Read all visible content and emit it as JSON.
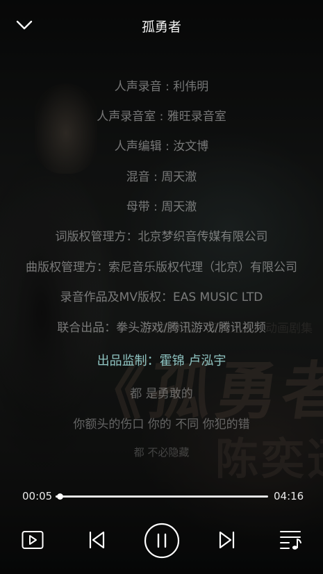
{
  "header": {
    "title": "孤勇者",
    "back_icon": "chevron-down-icon"
  },
  "lyrics": [
    "人声录音 : 利伟明",
    "人声录音室 : 雅旺录音室",
    "人声编辑 : 汝文博",
    "混音 : 周天澈",
    "母带 : 周天澈",
    "词版权管理方：北京梦织音传媒有限公司",
    "曲版权管理方：索尼音乐版权代理（北京）有限公司",
    "录音作品及MV版权：EAS MUSIC LTD",
    "联合出品：拳头游戏/腾讯游戏/腾讯视频",
    "出品监制：霍锦 卢泓宇",
    "都 是勇敢的",
    "你额头的伤口 你的 不同 你犯的错",
    "都 不必隐藏"
  ],
  "active_lyric_index": 9,
  "poster": {
    "title": "《孤勇者",
    "subtitle": "陈奕迅",
    "tag": "《英雄联盟：双城之战》动画剧集"
  },
  "playback": {
    "current_time": "00:05",
    "total_time": "04:16",
    "progress_fraction": 0.02
  },
  "controls": {
    "mv_icon": "video-play-icon",
    "prev_icon": "skip-previous-icon",
    "pause_icon": "pause-icon",
    "next_icon": "skip-next-icon",
    "playlist_icon": "playlist-icon"
  },
  "colors": {
    "active_lyric": "#8fc4c2",
    "lyric": "#cdcdcd",
    "background": "#141615"
  }
}
